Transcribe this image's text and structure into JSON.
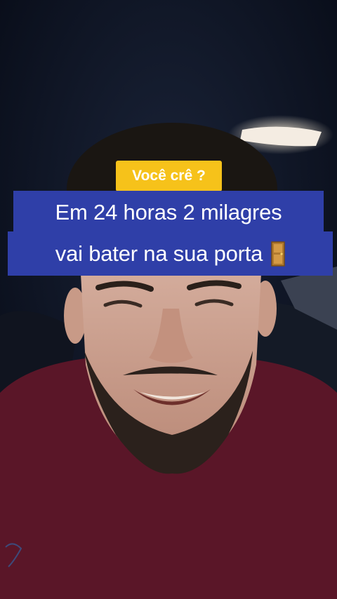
{
  "captions": {
    "question": "Você crê ?",
    "line1": "Em 24 horas 2 milagres",
    "line2": "vai bater na sua porta"
  },
  "icons": {
    "door": "door-icon"
  },
  "colors": {
    "question_bg": "#f6c21a",
    "caption_bg": "#2f3fa8",
    "text": "#ffffff",
    "shirt": "#5a1628"
  }
}
